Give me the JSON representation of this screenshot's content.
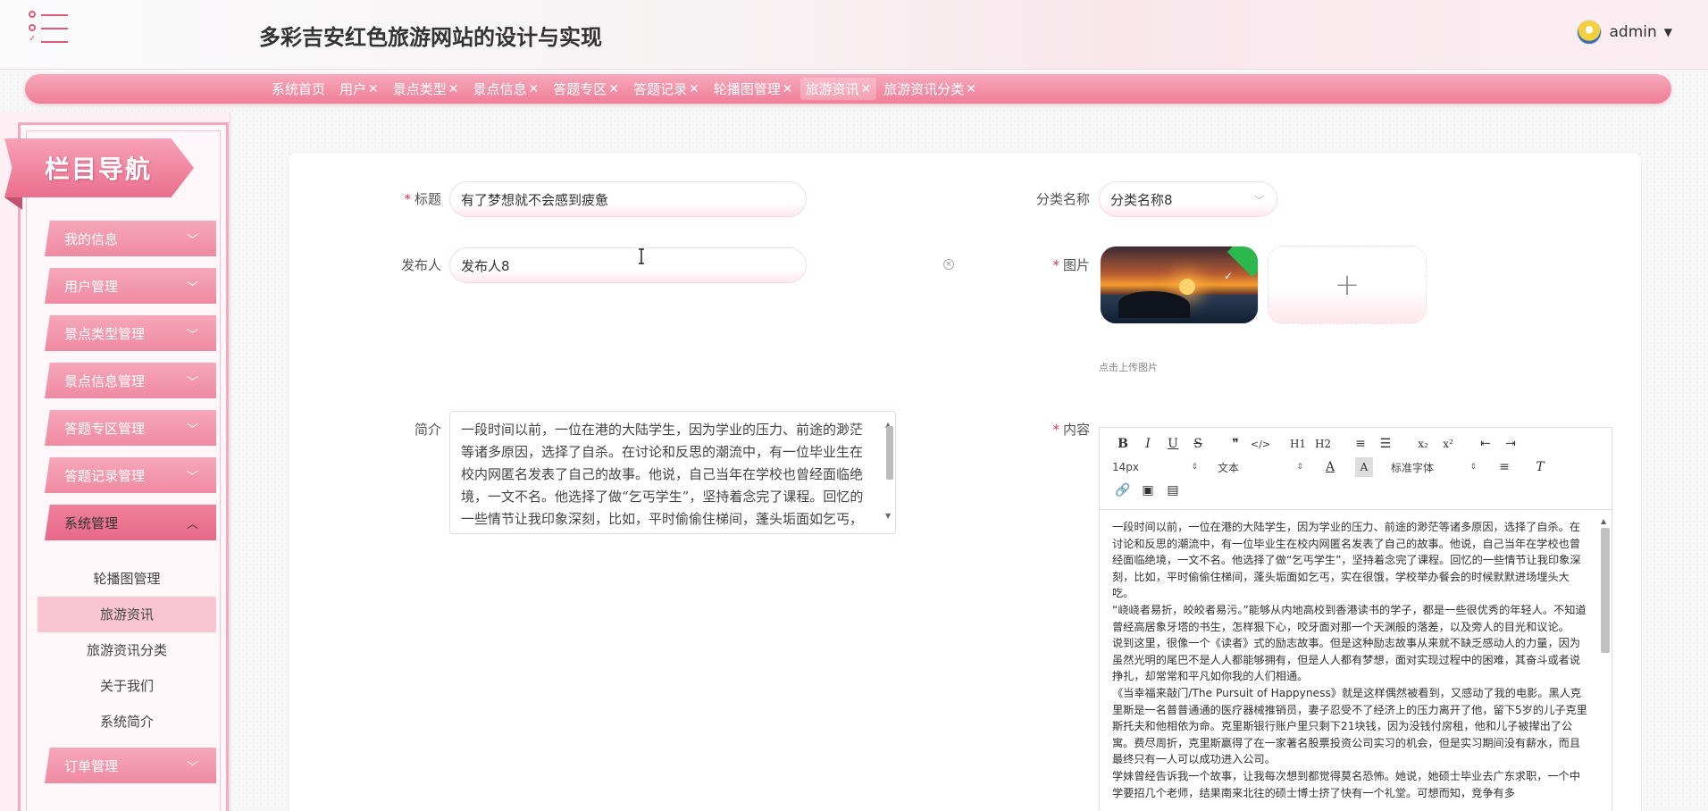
{
  "header": {
    "site_title": "多彩吉安红色旅游网站的设计与实现",
    "username": "admin",
    "caret": "▼"
  },
  "tabs": [
    {
      "label": "系统首页",
      "closable": false
    },
    {
      "label": "用户",
      "closable": true
    },
    {
      "label": "景点类型",
      "closable": true
    },
    {
      "label": "景点信息",
      "closable": true
    },
    {
      "label": "答题专区",
      "closable": true
    },
    {
      "label": "答题记录",
      "closable": true
    },
    {
      "label": "轮播图管理",
      "closable": true
    },
    {
      "label": "旅游资讯",
      "closable": true,
      "active": true
    },
    {
      "label": "旅游资讯分类",
      "closable": true
    }
  ],
  "tab_close": "✕",
  "sidebar": {
    "banner": "栏目导航",
    "menus": [
      {
        "label": "我的信息"
      },
      {
        "label": "用户管理"
      },
      {
        "label": "景点类型管理"
      },
      {
        "label": "景点信息管理"
      },
      {
        "label": "答题专区管理"
      },
      {
        "label": "答题记录管理"
      },
      {
        "label": "系统管理",
        "open": true
      },
      {
        "label": "订单管理"
      }
    ],
    "submenu": [
      {
        "label": "轮播图管理"
      },
      {
        "label": "旅游资讯",
        "active": true
      },
      {
        "label": "旅游资讯分类"
      },
      {
        "label": "关于我们"
      },
      {
        "label": "系统简介"
      }
    ]
  },
  "form": {
    "title_label": "标题",
    "title_value": "有了梦想就不会感到疲惫",
    "category_label": "分类名称",
    "category_value": "分类名称8",
    "publisher_label": "发布人",
    "publisher_value": "发布人8",
    "image_label": "图片",
    "upload_plus": "+",
    "upload_tip": "点击上传图片",
    "intro_label": "简介",
    "intro_value": "一段时间以前，一位在港的大陆学生，因为学业的压力、前途的渺茫等诸多原因，选择了自杀。在讨论和反思的潮流中，有一位毕业生在校内网匿名发表了自己的故事。他说，自己当年在学校也曾经面临绝境，一文不名。他选择了做“乞丐学生”，坚持着念完了课程。回忆的一些情节让我印象深刻，比如，平时偷偷住梯间，蓬头垢面如乞丐，实在很饿，学校举办餐会的时候默默进场埋头大吃。",
    "content_label": "内容",
    "required_mark": "*"
  },
  "editor": {
    "toolbar_row1": [
      "B",
      "I",
      "U",
      "S",
      "❞",
      "</>",
      "H1",
      "H2",
      "≡",
      "☰",
      "x₂",
      "x²",
      "⇤",
      "⇥"
    ],
    "font_size": "14px",
    "text_style": "文本",
    "font_family": "标准字体",
    "content": [
      "一段时间以前，一位在港的大陆学生，因为学业的压力、前途的渺茫等诸多原因，选择了自杀。在讨论和反思的潮流中，有一位毕业生在校内网匿名发表了自己的故事。他说，自己当年在学校也曾经面临绝境，一文不名。他选择了做“乞丐学生”，坚持着念完了课程。回忆的一些情节让我印象深刻，比如，平时偷偷住梯间，蓬头垢面如乞丐，实在很饿，学校举办餐会的时候默默进场埋头大吃。",
      "“峣峣者易折，皎皎者易污。”能够从内地高校到香港读书的学子，都是一些很优秀的年轻人。不知道曾经高居象牙塔的书生，怎样狠下心，咬牙面对那一个天渊般的落差，以及旁人的目光和议论。",
      "说到这里，很像一个《读者》式的励志故事。但是这种励志故事从来就不缺乏感动人的力量，因为虽然光明的尾巴不是人人都能够拥有，但是人人都有梦想，面对实现过程中的困难，其奋斗或者说挣扎，却常常和平凡如你我的人们相通。",
      "《当幸福来敲门/The Pursuit of Happyness》就是这样偶然被看到，又感动了我的电影。黑人克里斯是一名普普通通的医疗器械推销员，妻子忍受不了经济上的压力离开了他，留下5岁的儿子克里斯托夫和他相依为命。克里斯银行账户里只剩下21块钱，因为没钱付房租，他和儿子被撵出了公寓。费尽周折，克里斯赢得了在一家著名股票投资公司实习的机会，但是实习期间没有薪水，而且最终只有一人可以成功进入公司。",
      "学妹曾经告诉我一个故事，让我每次想到都觉得莫名恐怖。她说，她硕士毕业去广东求职，一个中学要招几个老师，结果南来北往的硕士博士挤了快有一个礼堂。可想而知，竞争有多"
    ]
  }
}
